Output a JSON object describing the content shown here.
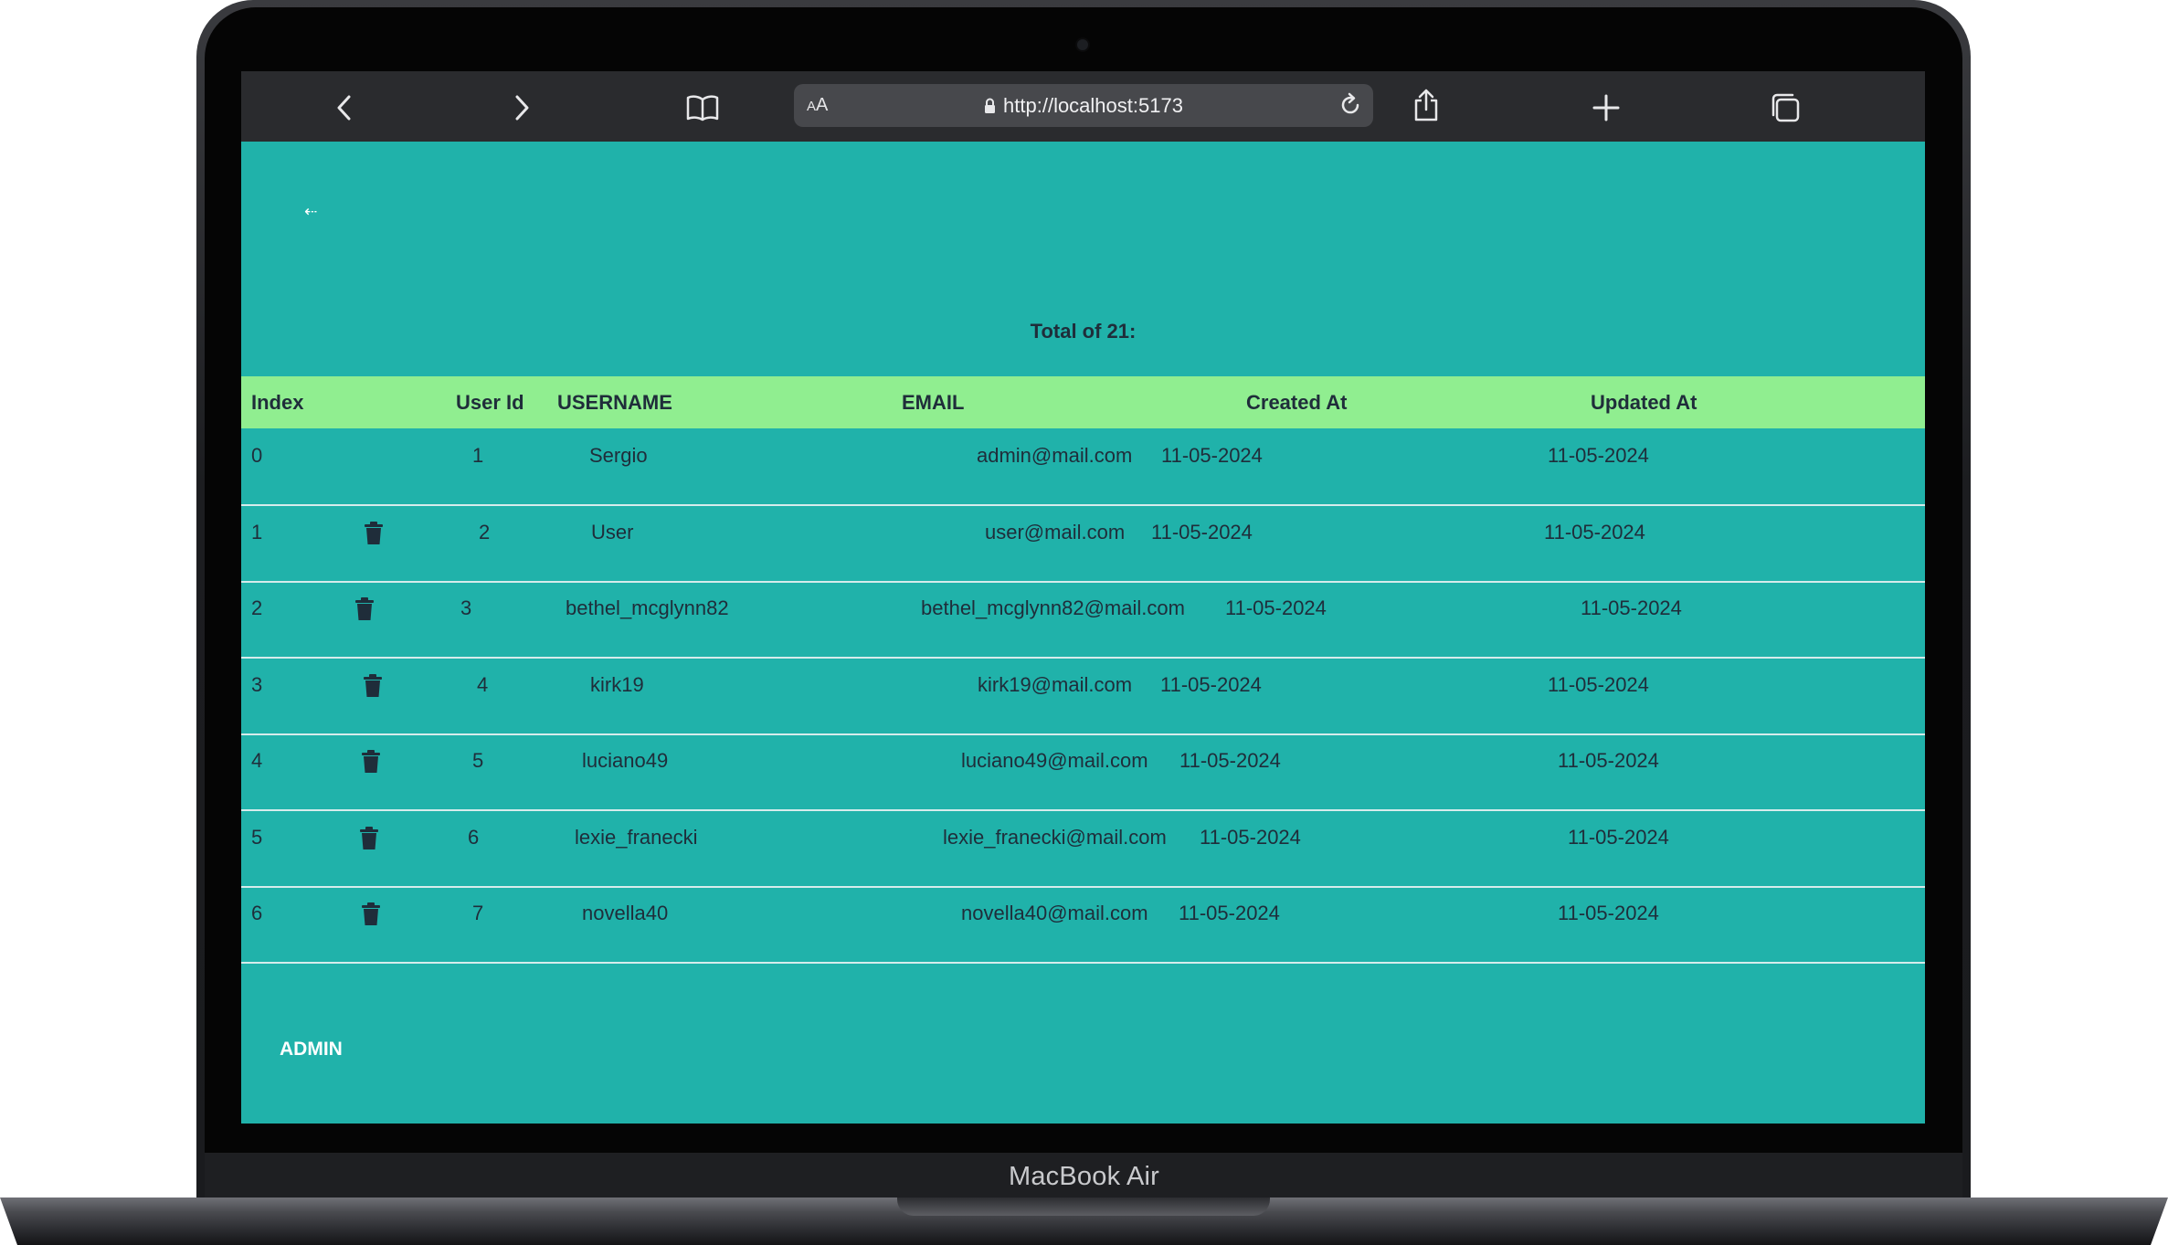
{
  "device": {
    "brand_label": "MacBook Air"
  },
  "browser": {
    "url": "http://localhost:5173",
    "text_size_label": "AA",
    "icons": [
      "chevron-left-icon",
      "chevron-right-icon",
      "book-icon",
      "lock-icon",
      "reload-icon",
      "share-icon",
      "plus-icon",
      "tabs-icon"
    ]
  },
  "page": {
    "back_link": "⇠",
    "total_label": "Total of 21:",
    "admin_label": "ADMIN",
    "colors": {
      "background": "#20b2aa",
      "header_row": "#90ee90",
      "text": "#1f2d3a"
    }
  },
  "table": {
    "headers": [
      "Index",
      "User Id",
      "USERNAME",
      "EMAIL",
      "Created At",
      "Updated At"
    ],
    "rows": [
      {
        "index": "0",
        "has_delete": false,
        "user_id": "1",
        "username": "Sergio",
        "email": "admin@mail.com",
        "created_at": "11-05-2024",
        "updated_at": "11-05-2024"
      },
      {
        "index": "1",
        "has_delete": true,
        "user_id": "2",
        "username": "User",
        "email": "user@mail.com",
        "created_at": "11-05-2024",
        "updated_at": "11-05-2024"
      },
      {
        "index": "2",
        "has_delete": true,
        "user_id": "3",
        "username": "bethel_mcglynn82",
        "email": "bethel_mcglynn82@mail.com",
        "created_at": "11-05-2024",
        "updated_at": "11-05-2024"
      },
      {
        "index": "3",
        "has_delete": true,
        "user_id": "4",
        "username": "kirk19",
        "email": "kirk19@mail.com",
        "created_at": "11-05-2024",
        "updated_at": "11-05-2024"
      },
      {
        "index": "4",
        "has_delete": true,
        "user_id": "5",
        "username": "luciano49",
        "email": "luciano49@mail.com",
        "created_at": "11-05-2024",
        "updated_at": "11-05-2024"
      },
      {
        "index": "5",
        "has_delete": true,
        "user_id": "6",
        "username": "lexie_franecki",
        "email": "lexie_franecki@mail.com",
        "created_at": "11-05-2024",
        "updated_at": "11-05-2024"
      },
      {
        "index": "6",
        "has_delete": true,
        "user_id": "7",
        "username": "novella40",
        "email": "novella40@mail.com",
        "created_at": "11-05-2024",
        "updated_at": "11-05-2024"
      }
    ]
  }
}
